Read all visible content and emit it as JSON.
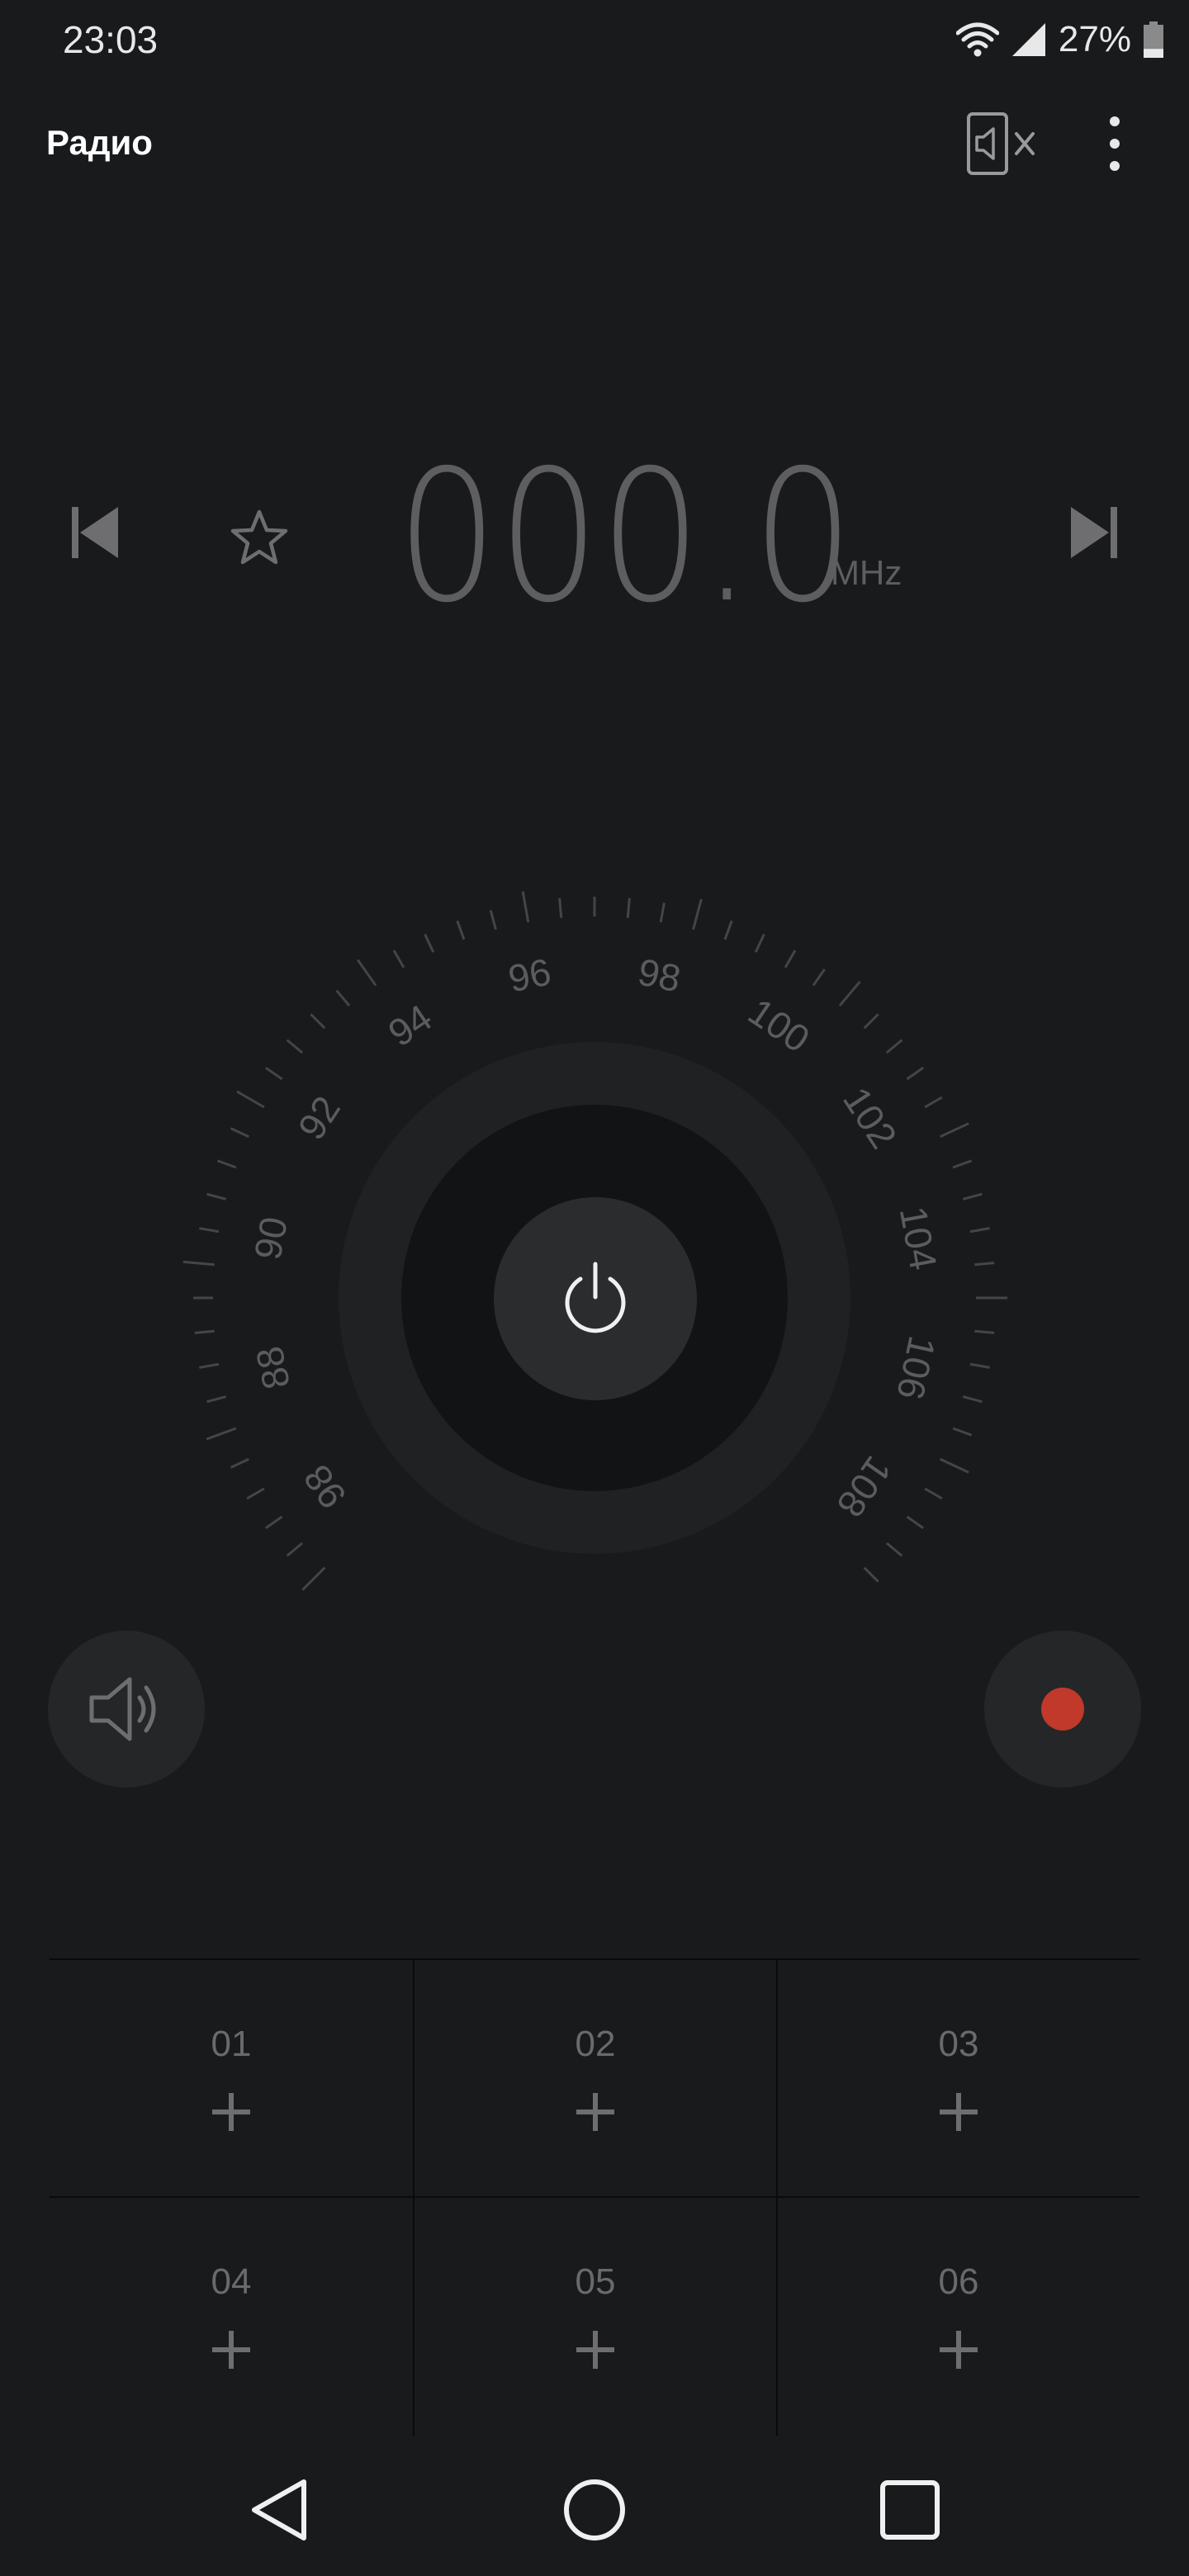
{
  "status_bar": {
    "time": "23:03",
    "battery_percent": "27%",
    "battery_level": 0.27,
    "wifi_icon": "wifi-icon",
    "signal_icon": "cellular-signal-icon",
    "battery_icon": "battery-icon"
  },
  "header": {
    "title": "Радио",
    "speaker_mute_icon": "speaker-off-icon",
    "more_icon": "more-vert-icon"
  },
  "tuner": {
    "frequency": "000.0",
    "unit": "MHz",
    "prev_icon": "skip-previous-icon",
    "favorite_icon": "star-outline-icon",
    "next_icon": "skip-next-icon"
  },
  "dial": {
    "labels": [
      "98",
      "88",
      "90",
      "92",
      "94",
      "96",
      "98",
      "100",
      "102",
      "104",
      "106",
      "108"
    ],
    "power_icon": "power-icon"
  },
  "controls": {
    "speaker_icon": "volume-icon",
    "record_icon": "record-icon",
    "record_color": "#c0392b"
  },
  "presets": [
    {
      "number": "01"
    },
    {
      "number": "02"
    },
    {
      "number": "03"
    },
    {
      "number": "04"
    },
    {
      "number": "05"
    },
    {
      "number": "06"
    }
  ],
  "navbar": {
    "back_icon": "back-triangle-icon",
    "home_icon": "home-circle-icon",
    "recents_icon": "recents-square-icon"
  }
}
